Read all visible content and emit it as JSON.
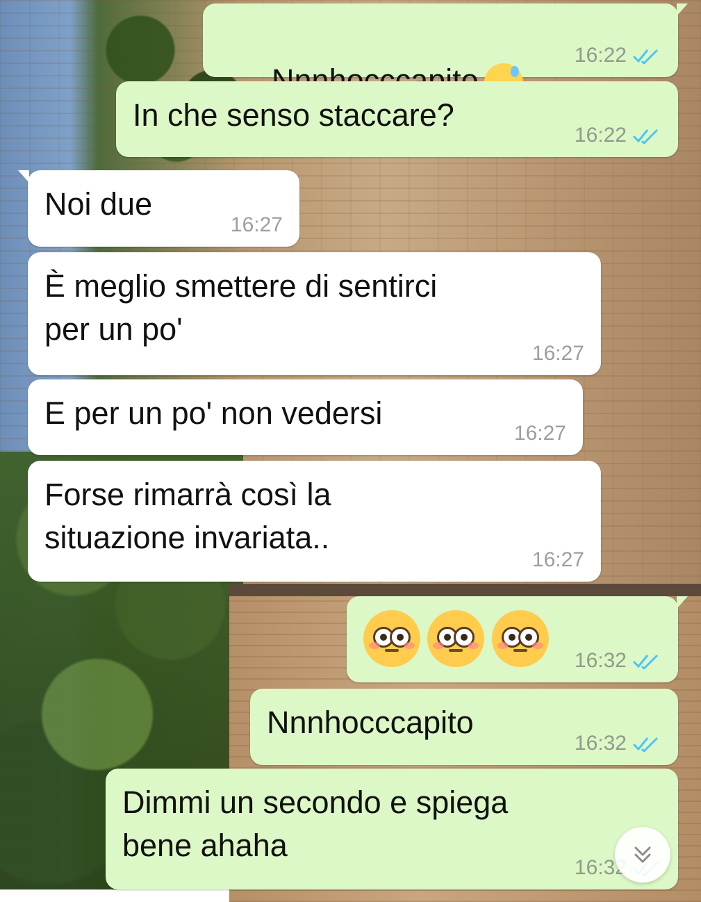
{
  "messages": [
    {
      "side": "out",
      "text": "Nnnhocccapito",
      "emoji": "grinning-sweat",
      "time": "16:22",
      "read": true
    },
    {
      "side": "out",
      "text": "In che senso staccare?",
      "time": "16:22",
      "read": true
    },
    {
      "side": "in",
      "text": "Noi due",
      "time": "16:27"
    },
    {
      "side": "in",
      "text": "È meglio smettere di sentirci\nper un po'",
      "time": "16:27"
    },
    {
      "side": "in",
      "text": "E per un po' non vedersi",
      "time": "16:27"
    },
    {
      "side": "in",
      "text": "Forse rimarrà così la\nsituazione invariata..",
      "time": "16:27"
    },
    {
      "side": "out",
      "text": "",
      "emoji": "flushed-x3",
      "time": "16:32",
      "read": true
    },
    {
      "side": "out",
      "text": "Nnnhocccapito",
      "time": "16:32",
      "read": true
    },
    {
      "side": "out",
      "text": "Dimmi un secondo e spiega\nbene ahaha",
      "time": "16:32",
      "read": true
    }
  ],
  "colors": {
    "outgoing_bubble": "#dcf8c6",
    "incoming_bubble": "#ffffff",
    "read_ticks": "#4fc3f7"
  },
  "icons": {
    "read_receipt": "double-check-icon",
    "scroll_down": "chevron-double-down-icon"
  }
}
